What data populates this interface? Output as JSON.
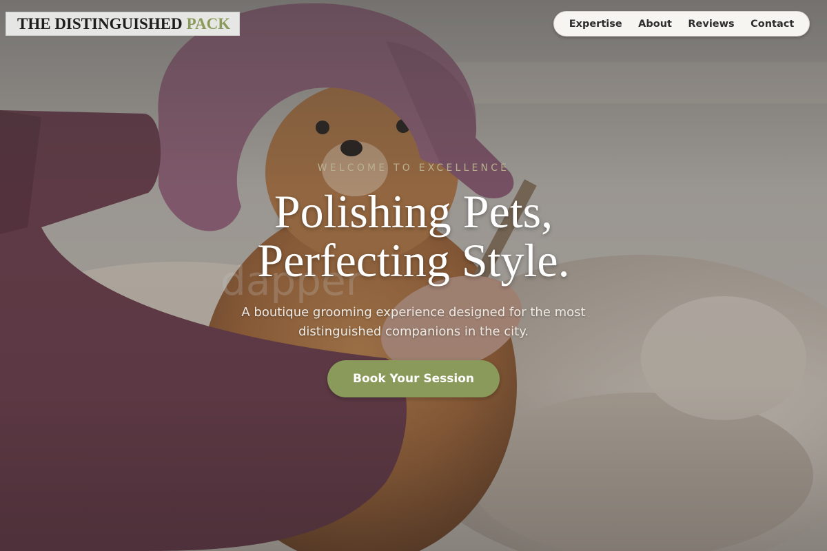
{
  "header": {
    "logo_main": "THE DISTINGUISHED",
    "logo_accent": "PACK"
  },
  "nav": {
    "items": [
      {
        "label": "Expertise"
      },
      {
        "label": "About"
      },
      {
        "label": "Reviews"
      },
      {
        "label": "Contact"
      }
    ]
  },
  "hero": {
    "eyebrow": "WELCOME TO EXCELLENCE",
    "headline_line1": "Polishing Pets,",
    "headline_line2": "Perfecting Style.",
    "subtitle": "A boutique grooming experience designed for the most distinguished companions in the city.",
    "cta_label": "Book Your Session",
    "background_image": "dog-in-pink-towel-being-groomed"
  },
  "colors": {
    "accent": "#8a9a5b",
    "eyebrow": "#b9b08f",
    "nav_bg": "#f6f5f1",
    "logo_bg": "#e6e6e4"
  }
}
